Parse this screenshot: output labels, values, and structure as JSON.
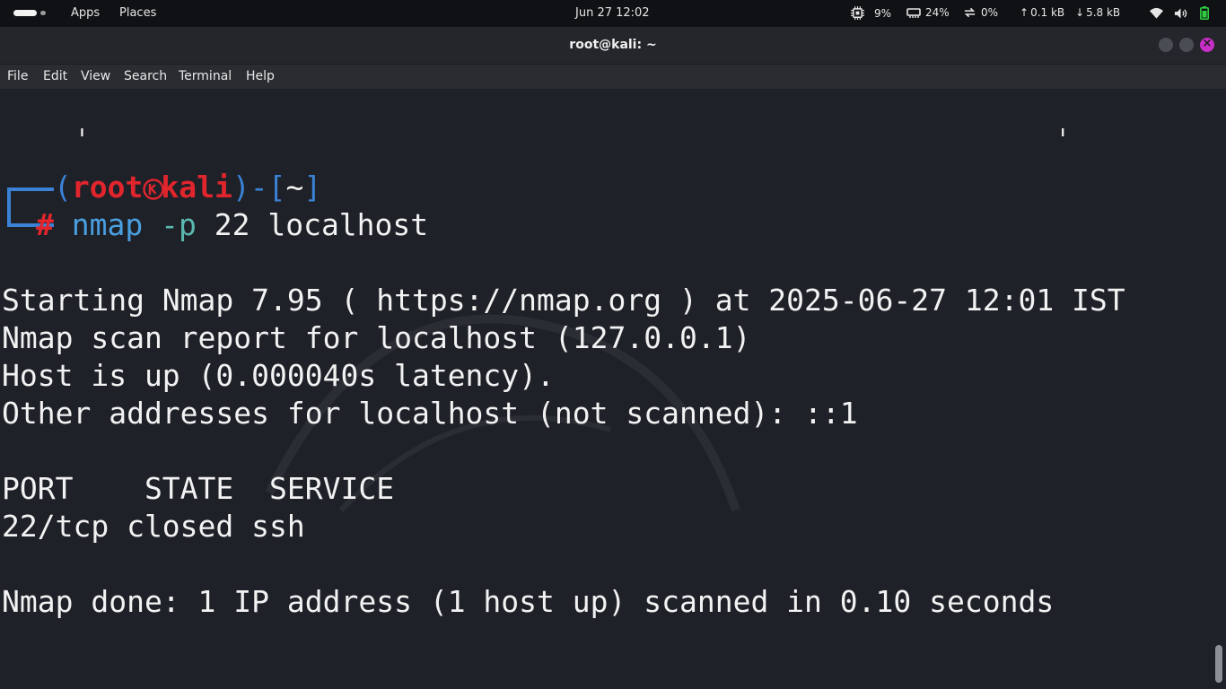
{
  "topbar": {
    "apps": "Apps",
    "places": "Places",
    "clock": "Jun 27  12:02",
    "cpu": "9%",
    "memory": "24%",
    "swap": "0%",
    "upload": "0.1 kB",
    "download": "5.8 kB"
  },
  "window": {
    "title": "root@kali: ~"
  },
  "menu": {
    "file": "File",
    "edit": "Edit",
    "view": "View",
    "search": "Search",
    "terminal": "Terminal",
    "help": "Help"
  },
  "terminal": {
    "prompt": {
      "open": "(",
      "user": "root",
      "host": "kali",
      "close": ")-[",
      "cwd": "~",
      "end": "]",
      "symbol": "#",
      "command": "nmap",
      "flag": "-p",
      "args": "22 localhost"
    },
    "output": [
      "Starting Nmap 7.95 ( https://nmap.org ) at 2025-06-27 12:01 IST",
      "Nmap scan report for localhost (127.0.0.1)",
      "Host is up (0.000040s latency).",
      "Other addresses for localhost (not scanned): ::1",
      "",
      "PORT    STATE  SERVICE",
      "22/tcp closed ssh",
      "",
      "Nmap done: 1 IP address (1 host up) scanned in 0.10 seconds"
    ]
  },
  "colors": {
    "prompt_blue": "#3b82d6",
    "prompt_red": "#e0252d",
    "close_button": "#c72fc7"
  }
}
